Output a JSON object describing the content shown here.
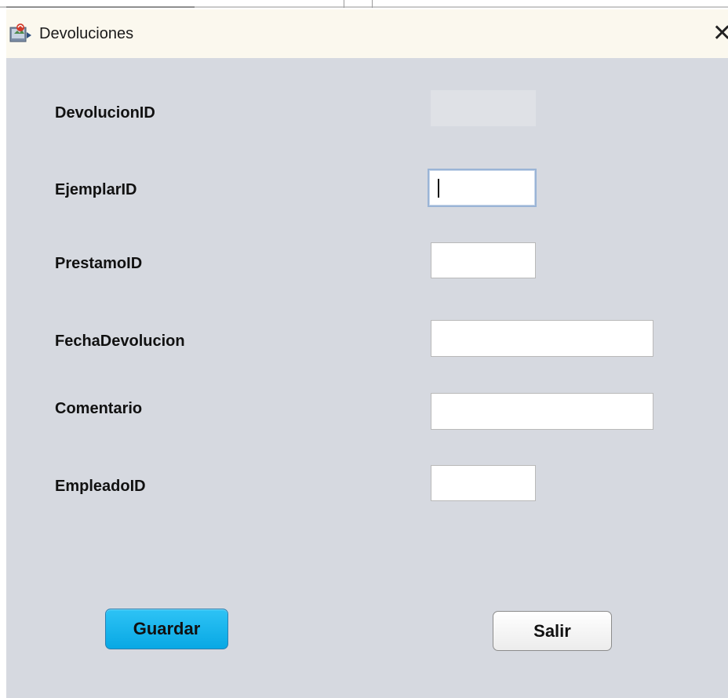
{
  "window": {
    "title": "Devoluciones",
    "close_glyph": "✕"
  },
  "form": {
    "fields": [
      {
        "label": "DevolucionID",
        "value": "",
        "state": "disabled"
      },
      {
        "label": "EjemplarID",
        "value": "",
        "state": "focused"
      },
      {
        "label": "PrestamoID",
        "value": "",
        "state": "normal"
      },
      {
        "label": "FechaDevolucion",
        "value": "",
        "state": "normal"
      },
      {
        "label": "Comentario",
        "value": "",
        "state": "normal"
      },
      {
        "label": "EmpleadoID",
        "value": "",
        "state": "normal"
      }
    ]
  },
  "buttons": {
    "save_label": "Guardar",
    "exit_label": "Salir"
  },
  "colors": {
    "window_background": "#d6d9e0",
    "titlebar_background": "#fbf8ee",
    "primary_button": "#08a8e4",
    "focus_border": "#9ab4d6"
  },
  "icons": {
    "app": "java-cup-icon",
    "close": "close-icon"
  }
}
